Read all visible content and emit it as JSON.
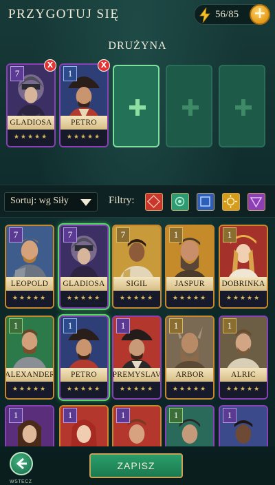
{
  "header": {
    "title": "PRZYGOTUJ SIĘ",
    "energy": "56/85",
    "energy_plus": "+"
  },
  "team": {
    "title": "DRUŻYNA",
    "members": [
      {
        "name": "GLADIOSA",
        "level": "7",
        "stars": "★★★★★"
      },
      {
        "name": "PETRO",
        "level": "1",
        "stars": "★★★★★"
      }
    ],
    "remove_label": "X",
    "empty_slots": 3
  },
  "toolbar": {
    "sort_label": "Sortuj: wg Siły",
    "filters_label": "Filtry:",
    "filters": [
      {
        "name": "red-filter",
        "color": "#c8362c"
      },
      {
        "name": "green-filter",
        "color": "#2d9a72"
      },
      {
        "name": "blue-filter",
        "color": "#2d5fb8"
      },
      {
        "name": "gold-filter",
        "color": "#d59b1c"
      },
      {
        "name": "purple-filter",
        "color": "#8d3fb4"
      }
    ]
  },
  "roster": {
    "row1": [
      {
        "name": "LEOPOLD",
        "level": "7",
        "stars": "★★★★★"
      },
      {
        "name": "GLADIOSA",
        "level": "7",
        "stars": "★★★★★"
      },
      {
        "name": "SIGIL",
        "level": "7",
        "stars": "★★★★★"
      },
      {
        "name": "JASPUR",
        "level": "1",
        "stars": "★★★★★"
      },
      {
        "name": "DOBRINKA",
        "level": "1",
        "stars": "★★★★★"
      }
    ],
    "row2": [
      {
        "name": "ALEXANDER",
        "level": "1",
        "stars": "★★★★★"
      },
      {
        "name": "PETRO",
        "level": "1",
        "stars": "★★★★★"
      },
      {
        "name": "PREMYSLAV",
        "level": "1",
        "stars": "★★★★★"
      },
      {
        "name": "ARBOR",
        "level": "1",
        "stars": "★★★★★"
      },
      {
        "name": "ALRIC",
        "level": "1",
        "stars": "★★★★★"
      }
    ],
    "row3": [
      {
        "level": "1"
      },
      {
        "level": "1"
      },
      {
        "level": "1"
      },
      {
        "level": "1"
      },
      {
        "level": "1"
      }
    ]
  },
  "bottom": {
    "back_label": "WSTECZ",
    "save_label": "ZAPISZ"
  }
}
